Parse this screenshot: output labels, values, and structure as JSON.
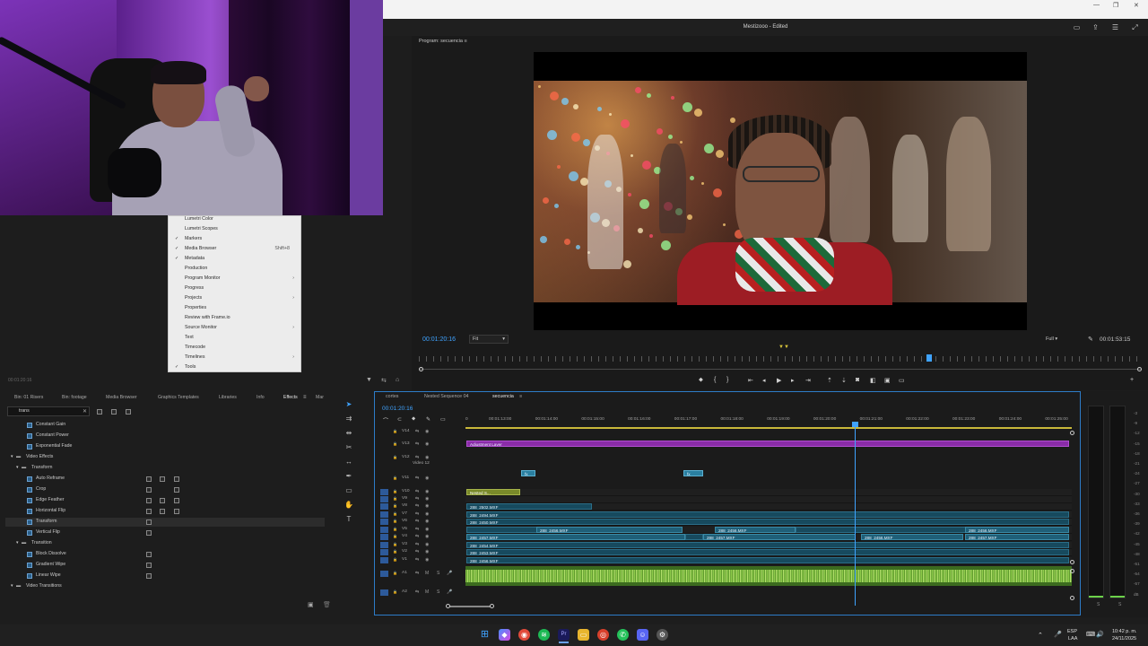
{
  "app": {
    "title": "Mestizooo - Edited"
  },
  "program": {
    "panel_title": "Program: secuencia",
    "timecode": "00:01:20:16",
    "fit": "Fit",
    "quality": "Full",
    "duration": "00:01:53:15"
  },
  "context_menu": {
    "items": [
      {
        "label": "Lumetri Color",
        "checked": false
      },
      {
        "label": "Lumetri Scopes",
        "checked": false
      },
      {
        "label": "Markers",
        "checked": true
      },
      {
        "label": "Media Browser",
        "checked": true,
        "shortcut": "Shift+8"
      },
      {
        "label": "Metadata",
        "checked": true
      },
      {
        "label": "Production",
        "checked": false
      },
      {
        "label": "Program Monitor",
        "checked": false,
        "submenu": true
      },
      {
        "label": "Progress",
        "checked": false
      },
      {
        "label": "Projects",
        "checked": false,
        "submenu": true
      },
      {
        "label": "Properties",
        "checked": false
      },
      {
        "label": "Review with Frame.io",
        "checked": false
      },
      {
        "label": "Source Monitor",
        "checked": false,
        "submenu": true
      },
      {
        "label": "Text",
        "checked": false
      },
      {
        "label": "Timecode",
        "checked": false
      },
      {
        "label": "Timelines",
        "checked": false,
        "submenu": true
      },
      {
        "label": "Tools",
        "checked": true
      }
    ]
  },
  "left_status": "00:01:20:16",
  "effects_panel": {
    "tabs": [
      "Bin: 01 Risers",
      "Bin: footage",
      "Media Browser",
      "Graphics Templates",
      "Libraries",
      "Info",
      "Effects",
      "Mar"
    ],
    "active_tab": "Effects",
    "search_value": "trans",
    "tree": [
      {
        "label": "Constant Gain",
        "level": 2,
        "type": "fx"
      },
      {
        "label": "Constant Power",
        "level": 2,
        "type": "fx"
      },
      {
        "label": "Exponential Fade",
        "level": 2,
        "type": "fx"
      },
      {
        "label": "Video Effects",
        "level": 0,
        "type": "folder"
      },
      {
        "label": "Transform",
        "level": 1,
        "type": "folder"
      },
      {
        "label": "Auto Reframe",
        "level": 2,
        "type": "fx"
      },
      {
        "label": "Crop",
        "level": 2,
        "type": "fx"
      },
      {
        "label": "Edge Feather",
        "level": 2,
        "type": "fx"
      },
      {
        "label": "Horizontal Flip",
        "level": 2,
        "type": "fx"
      },
      {
        "label": "Transform",
        "level": 2,
        "type": "fx"
      },
      {
        "label": "Vertical Flip",
        "level": 2,
        "type": "fx"
      },
      {
        "label": "Transition",
        "level": 1,
        "type": "folder"
      },
      {
        "label": "Block Dissolve",
        "level": 2,
        "type": "fx"
      },
      {
        "label": "Gradient Wipe",
        "level": 2,
        "type": "fx"
      },
      {
        "label": "Linear Wipe",
        "level": 2,
        "type": "fx"
      },
      {
        "label": "Video Transitions",
        "level": 0,
        "type": "folder"
      }
    ]
  },
  "timeline": {
    "tabs": [
      "cortes",
      "Nested Sequence 04",
      "secuencia"
    ],
    "active_tab": "secuencia",
    "timecode": "00:01:20:16",
    "ruler": [
      "0",
      "00:01:13:00",
      "00:01:14:00",
      "00:01:15:00",
      "00:01:16:00",
      "00:01:17:00",
      "00:01:18:00",
      "00:01:19:00",
      "00:01:20:00",
      "00:01:21:00",
      "00:01:22:00",
      "00:01:23:00",
      "00:01:24:00",
      "00:01:25:00"
    ],
    "video12_label": "Video 12",
    "tracks": [
      "V14",
      "V13",
      "V12",
      "V11",
      "V10",
      "V9",
      "V8",
      "V7",
      "V6",
      "V5",
      "V4",
      "V3",
      "V2",
      "V1",
      "A1",
      "A2"
    ],
    "clips": {
      "adjustment": "Adjustment Layer",
      "nested": "Nested S...",
      "v8": "288_2502.MXF",
      "v7": "288_2494.MXF",
      "v6": "288_2450.MXF",
      "v5a": "288_2456.MXF",
      "v5b": "288_2456.MXF",
      "v5c": "288_2456.MXF",
      "v4a": "288_2457.MXF",
      "v4b": "288_2457.MXF",
      "v4c": "288_2456.MXF",
      "v4d": "288_2457.MXF",
      "v3": "288_2454.MXF",
      "v2": "288_2453.MXF",
      "v1": "288_2456.MXF",
      "fx": "fx"
    }
  },
  "meters": {
    "labels": [
      "-3",
      "-9",
      "-12",
      "-15",
      "-18",
      "-21",
      "-24",
      "-27",
      "-30",
      "-33",
      "-36",
      "-39",
      "-42",
      "-45",
      "-48",
      "-51",
      "-54",
      "-57",
      "dB"
    ],
    "channels": [
      "S",
      "S"
    ]
  },
  "taskbar": {
    "lang_top": "ESP",
    "lang_bottom": "LAA",
    "time": "10:42 p. m.",
    "date": "24/11/2025"
  }
}
